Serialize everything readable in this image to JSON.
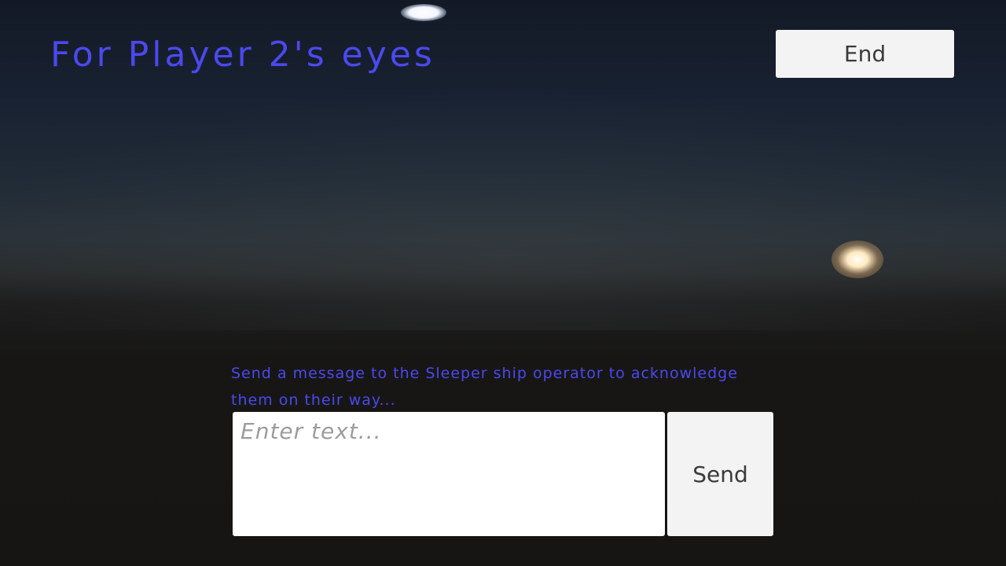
{
  "header": {
    "title": "For Player 2's eyes",
    "end_label": "End"
  },
  "message": {
    "prompt": "Send a message to the Sleeper ship operator to acknowledge them on their way...",
    "input_placeholder": "Enter text...",
    "input_value": "",
    "send_label": "Send"
  },
  "colors": {
    "accent_text": "#4b49ee",
    "button_background": "#f3f3f3",
    "button_text": "#3a3a3a"
  }
}
